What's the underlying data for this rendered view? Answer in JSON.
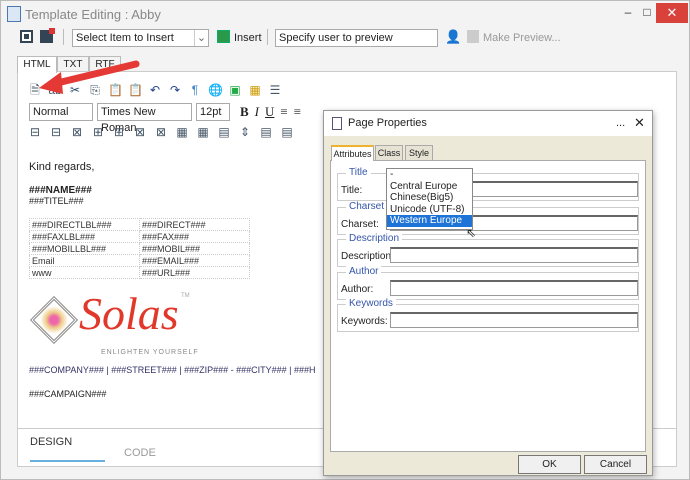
{
  "window": {
    "title": "Template Editing : Abby",
    "minimize": "–",
    "maximize": "□",
    "close": "✕"
  },
  "toolbar": {
    "insert_select": "Select Item to Insert",
    "insert_label": "Insert",
    "preview_input": "Specify user to preview",
    "make_preview": "Make Preview..."
  },
  "tabs": [
    "HTML",
    "TXT",
    "RTF"
  ],
  "format": {
    "style": "Normal",
    "font": "Times New Roman",
    "size": "12pt"
  },
  "content": {
    "greeting": "Kind regards,",
    "name": "###NAME###",
    "titel": "###TITEL###",
    "rows": [
      [
        "###DIRECTLBL###",
        "###DIRECT###"
      ],
      [
        "###FAXLBL###",
        "###FAX###"
      ],
      [
        "###MOBILLBL###",
        "###MOBIL###"
      ],
      [
        "Email",
        "###EMAIL###"
      ],
      [
        "www",
        "###URL###"
      ]
    ],
    "logo": {
      "text": "Solas",
      "tagline": "ENLIGHTEN YOURSELF",
      "tm": "TM"
    },
    "address": "###COMPANY### | ###STREET### | ###ZIP### - ###CITY### | ###H",
    "campaign": "###CAMPAIGN###"
  },
  "bottom_tabs": {
    "design": "DESIGN",
    "code": "CODE",
    "active": "DESIGN"
  },
  "dialog": {
    "title": "Page Properties",
    "more": "...",
    "close": "✕",
    "tabs": [
      "Attributes",
      "Class",
      "Style"
    ],
    "groups": [
      {
        "legend": "Title",
        "label": "Title:"
      },
      {
        "legend": "Charset",
        "label": "Charset:"
      },
      {
        "legend": "Description",
        "label": "Description:"
      },
      {
        "legend": "Author",
        "label": "Author:"
      },
      {
        "legend": "Keywords",
        "label": "Keywords:"
      }
    ],
    "charset_options": [
      "-",
      "Central Europe",
      "Chinese(Big5)",
      "Unicode (UTF-8)",
      "Western Europe"
    ],
    "charset_highlighted": "Western Europe",
    "ok": "OK",
    "cancel": "Cancel"
  },
  "colors": {
    "accent": "#1e73d6",
    "close": "#d9413b",
    "arrow": "#e53935",
    "logo": "#e0392b"
  }
}
